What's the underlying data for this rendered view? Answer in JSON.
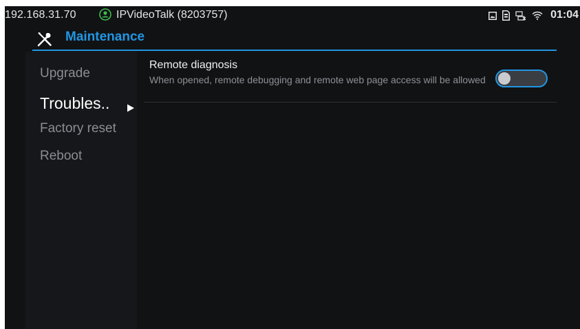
{
  "status_bar": {
    "ip": "192.168.31.70",
    "account": "IPVideoTalk (8203757)",
    "time": "01:04",
    "account_icon": "account-registered-icon",
    "icons": [
      "image-icon",
      "sim-card-icon",
      "no-network-icon",
      "wifi-icon"
    ]
  },
  "header": {
    "icon": "tools-icon",
    "title": "Maintenance",
    "accent": "#2196e3"
  },
  "sidebar": {
    "items": [
      {
        "label": "Upgrade",
        "active": false
      },
      {
        "label": "Troubles..",
        "active": true
      },
      {
        "label": "Factory reset",
        "active": false
      },
      {
        "label": "Reboot",
        "active": false
      }
    ],
    "active_indicator": "play-arrow-icon"
  },
  "content": {
    "setting": {
      "title": "Remote diagnosis",
      "description": "When opened, remote debugging and remote web page access will be allowed",
      "enabled": false
    }
  },
  "colors": {
    "background": "#111214",
    "sidebar_bg": "#16171a",
    "accent": "#2196e3",
    "online_status": "#3dbb4e"
  }
}
